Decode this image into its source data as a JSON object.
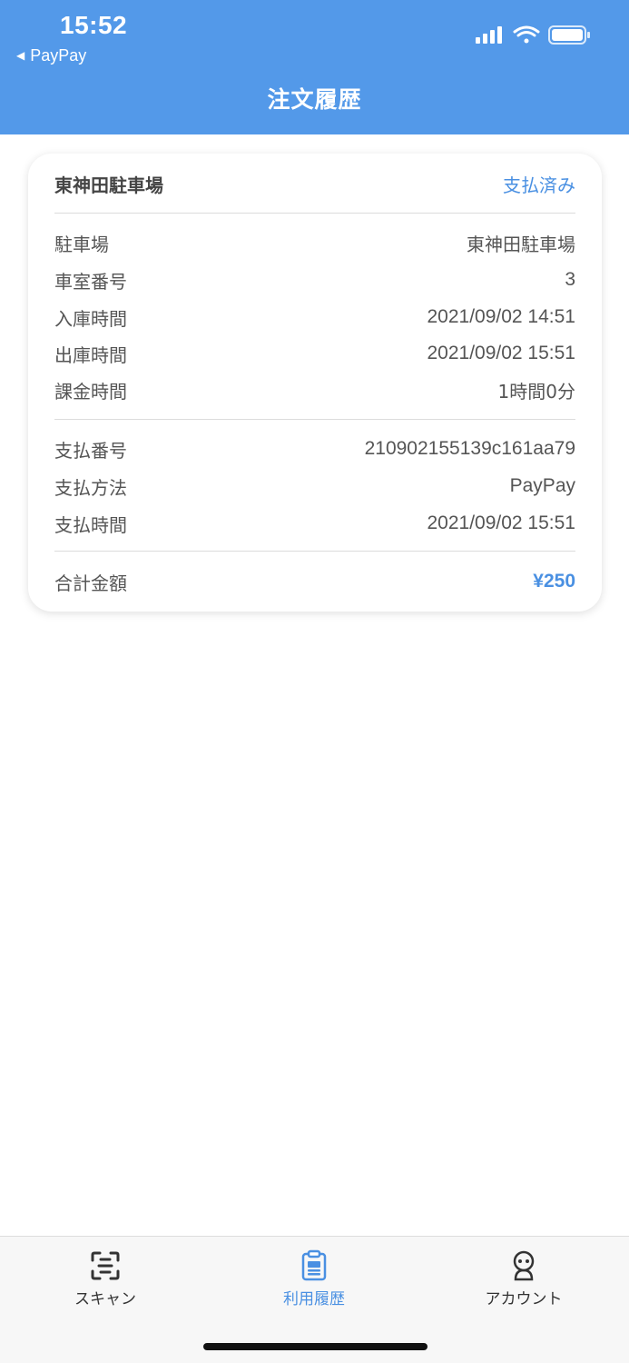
{
  "status_bar": {
    "time": "15:52",
    "back_app": "PayPay",
    "icons": [
      "signal-icon",
      "wifi-icon",
      "battery-icon"
    ]
  },
  "header": {
    "title": "注文履歴",
    "background": "#5399e9"
  },
  "order": {
    "name": "東神田駐車場",
    "status": "支払済み",
    "parking": [
      {
        "label": "駐車場",
        "value": "東神田駐車場"
      },
      {
        "label": "車室番号",
        "value": "3"
      },
      {
        "label": "入庫時間",
        "value": "2021/09/02 14:51"
      },
      {
        "label": "出庫時間",
        "value": "2021/09/02 15:51"
      },
      {
        "label": "課金時間",
        "value": "1時間0分"
      }
    ],
    "payment": [
      {
        "label": "支払番号",
        "value": "210902155139c161aa79"
      },
      {
        "label": "支払方法",
        "value": "PayPay"
      },
      {
        "label": "支払時間",
        "value": "2021/09/02 15:51"
      }
    ],
    "total": {
      "label": "合計金額",
      "value": "¥250"
    }
  },
  "tabbar": {
    "tabs": [
      {
        "label": "スキャン",
        "icon": "scan-icon",
        "active": false
      },
      {
        "label": "利用履歴",
        "icon": "history-icon",
        "active": true
      },
      {
        "label": "アカウント",
        "icon": "account-icon",
        "active": false
      }
    ]
  },
  "colors": {
    "accent": "#4a90e2",
    "header": "#5399e9",
    "text": "#555555"
  }
}
